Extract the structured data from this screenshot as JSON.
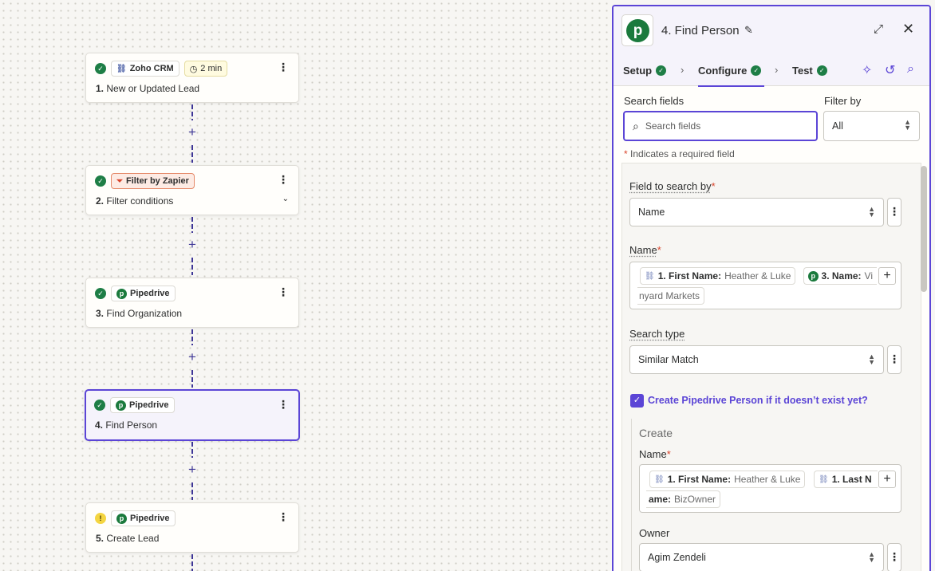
{
  "canvas": {
    "steps": [
      {
        "status": "ok",
        "app_icon": "link-icon",
        "app": "Zoho CRM",
        "time_badge": "2 min",
        "num": "1.",
        "title": "New or Updated Lead"
      },
      {
        "status": "ok",
        "app_icon": "filter-icon",
        "app": "Filter by Zapier",
        "num": "2.",
        "title": "Filter conditions"
      },
      {
        "status": "ok",
        "app_icon": "pipedrive-logo",
        "app": "Pipedrive",
        "num": "3.",
        "title": "Find Organization"
      },
      {
        "status": "ok",
        "app_icon": "pipedrive-logo",
        "app": "Pipedrive",
        "num": "4.",
        "title": "Find Person"
      },
      {
        "status": "warning",
        "app_icon": "pipedrive-logo",
        "app": "Pipedrive",
        "num": "5.",
        "title": "Create Lead"
      }
    ]
  },
  "panel": {
    "title": "4. Find Person",
    "tabs": [
      {
        "label": "Setup",
        "done": true
      },
      {
        "label": "Configure",
        "done": true,
        "active": true
      },
      {
        "label": "Test",
        "done": true
      }
    ],
    "search_label": "Search fields",
    "search_placeholder": "Search fields",
    "filter_label": "Filter by",
    "filter_value": "All",
    "required_note": "Indicates a required field",
    "required_star": "*",
    "field_to_search_label": "Field to search by",
    "field_to_search_value": "Name",
    "name_label": "Name",
    "name_pills": [
      {
        "key": "1. First Name:",
        "val": "Heather & Luke"
      },
      {
        "key": "3. Name:",
        "val": "Vi"
      },
      {
        "key": "",
        "val": "nyard Markets"
      }
    ],
    "search_type_label": "Search type",
    "search_type_value": "Similar Match",
    "create_checkbox_label": "Create Pipedrive Person if it doesn’t exist yet?",
    "create_heading": "Create",
    "create_name_label": "Name",
    "create_name_pills": [
      {
        "key": "1. First Name:",
        "val": "Heather & Luke"
      },
      {
        "key": "1. Last N",
        "val": ""
      },
      {
        "key": "ame:",
        "val": "BizOwner"
      }
    ],
    "owner_label": "Owner",
    "owner_value": "Agim Zendeli"
  },
  "colors": {
    "accent": "#5b45d6",
    "success": "#1e7e46",
    "pipedrive": "#1b7a3d",
    "warning": "#f4d541",
    "connector": "#3d3596"
  }
}
